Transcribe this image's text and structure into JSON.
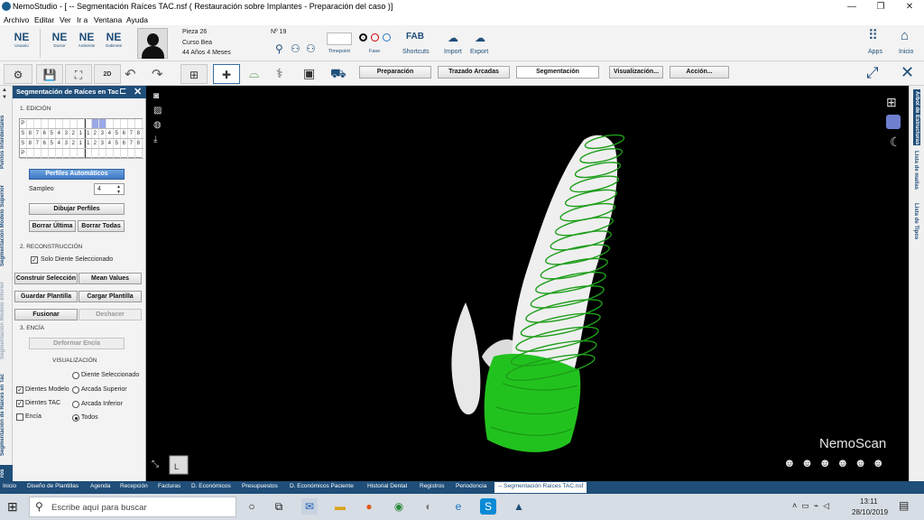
{
  "window": {
    "title": "NemoStudio - [ -- Segmentación Raíces TAC.nsf ( Restauración sobre Implantes - Preparación del caso )]",
    "controls": [
      "—",
      "❐",
      "✕"
    ]
  },
  "menu": [
    "Archivo",
    "Editar",
    "Ver",
    "Ir a",
    "Ventana",
    "Ayuda"
  ],
  "toolbar1": {
    "usuario": {
      "ne": "NE",
      "label": "Usuario"
    },
    "ne_buttons": [
      {
        "ne": "NE",
        "label": "Doctor"
      },
      {
        "ne": "NE",
        "label": "Asistente"
      },
      {
        "ne": "NE",
        "label": "Gabinete"
      }
    ],
    "patient": {
      "pieza": "Pieza 26",
      "name": "Curso Bea",
      "age": "44 Años 4 Meses",
      "number": "Nº 19"
    },
    "timepoint_label": "Timepoint",
    "fase_label": "Fase",
    "shortcuts": {
      "icon_text": "FAB",
      "label": "Shortcuts"
    },
    "import_label": "Import",
    "export_label": "Export",
    "apps_label": "Apps",
    "inicio_label": "Inicio"
  },
  "toolbar2": {
    "view_2d": "2D",
    "steps": [
      {
        "label": "Preparación",
        "active": false
      },
      {
        "label": "Trazado Arcadas",
        "active": false
      },
      {
        "label": "Segmentación",
        "active": true
      },
      {
        "label": "Visualización...",
        "active": false
      },
      {
        "label": "Acción...",
        "active": false
      }
    ]
  },
  "left_tabs": [
    {
      "label": "Puntos Interdentales",
      "state": "normal"
    },
    {
      "label": "Segmentación Modelo Superior",
      "state": "normal"
    },
    {
      "label": "Segmentación Modelo Inferior",
      "state": "dim"
    },
    {
      "label": "Segmentación de Raíces en Tac",
      "state": "normal"
    },
    {
      "label": "ros",
      "state": "blue"
    }
  ],
  "panel": {
    "title": "Segmentación de Raíces en Tac",
    "section1": "1. EDICIÓN",
    "tooth_rows": [
      {
        "prefix": "P",
        "cells": [
          "",
          "",
          "",
          "",
          "",
          "",
          "",
          "",
          "",
          "",
          "",
          "",
          "",
          "",
          "",
          ""
        ]
      },
      {
        "prefix": "S",
        "cells": [
          "8",
          "7",
          "6",
          "5",
          "4",
          "3",
          "2",
          "1",
          "1",
          "2",
          "3",
          "4",
          "5",
          "6",
          "7",
          "8"
        ]
      },
      {
        "prefix": "S",
        "cells": [
          "8",
          "7",
          "6",
          "5",
          "4",
          "3",
          "2",
          "1",
          "1",
          "2",
          "3",
          "4",
          "5",
          "6",
          "7",
          "8"
        ]
      },
      {
        "prefix": "P",
        "cells": [
          "",
          "",
          "",
          "",
          "",
          "",
          "",
          "",
          "",
          "",
          "",
          "",
          "",
          "",
          "",
          ""
        ]
      }
    ],
    "perfiles_automaticos": "Perfiles Automáticos",
    "sampleo_label": "Sampleo",
    "sampleo_value": "4",
    "dibujar_perfiles": "Dibujar Perfiles",
    "borrar_ultima": "Borrar Última",
    "borrar_todas": "Borrar Todas",
    "section2": "2. RECONSTRUCCIÓN",
    "solo_diente": "Solo Diente Seleccionado",
    "construir": "Construir Selección",
    "mean_values": "Mean Values",
    "guardar": "Guardar Plantilla",
    "cargar": "Cargar Plantilla",
    "fusionar": "Fusionar",
    "deshacer": "Deshacer",
    "section3": "3. ENCÍA",
    "deformar": "Deformar Encía",
    "visualizacion": "VISUALIZACIÓN",
    "checks": [
      {
        "label": "Dientes Modelo",
        "checked": true
      },
      {
        "label": "Dientes TAC",
        "checked": true
      },
      {
        "label": "Encía",
        "checked": false
      }
    ],
    "radios": [
      {
        "label": "Diente Seleccionado",
        "selected": false
      },
      {
        "label": "Arcada Superior",
        "selected": false
      },
      {
        "label": "Arcada Inferior",
        "selected": false
      },
      {
        "label": "Todos",
        "selected": true
      }
    ]
  },
  "viewport": {
    "brand": "NemoScan",
    "nav_cube_label": "L"
  },
  "right_tabs": [
    "Árbol de Estructuras",
    "Lista de mallas",
    "Lista de Tipos"
  ],
  "bottom_tabs": [
    {
      "label": "Inicio",
      "active": false
    },
    {
      "label": "Diseño de Plantillas",
      "active": false
    },
    {
      "label": "Agenda",
      "active": false
    },
    {
      "label": "Recepción",
      "active": false
    },
    {
      "label": "Facturas",
      "active": false
    },
    {
      "label": "D. Económicos",
      "active": false
    },
    {
      "label": "Presupuestos",
      "active": false
    },
    {
      "label": "D. Económicos Paciente",
      "active": false
    },
    {
      "label": "Historial Dental",
      "active": false
    },
    {
      "label": "Registros",
      "active": false
    },
    {
      "label": "Periodoncia",
      "active": false
    },
    {
      "label": "-- Segmentación Raíces TAC.nsf",
      "active": true
    }
  ],
  "taskbar": {
    "search_placeholder": "Escribe aquí para buscar",
    "time": "13:11",
    "date": "28/10/2019"
  }
}
